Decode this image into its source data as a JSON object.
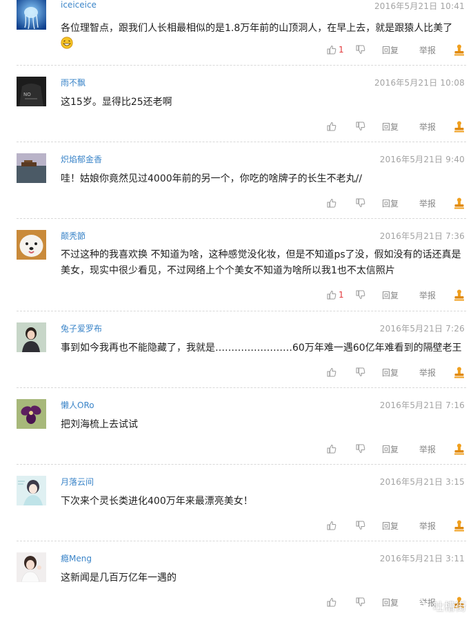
{
  "comments": [
    {
      "user": "iceiceice",
      "time": "2016年5月21日 10:41",
      "text": "各位理智点，跟我们人长相最相似的是1.8万年前的山顶洞人，在早上去，就是跟猿人比美了",
      "likes": "1",
      "reply": "回复",
      "report": "举报",
      "avatar": "jellyfish-avatar",
      "emoji": "grin-emoji"
    },
    {
      "user": "雨不飘",
      "time": "2016年5月21日 10:08",
      "text": "这15岁。显得比25还老啊",
      "likes": "",
      "reply": "回复",
      "report": "举报",
      "avatar": "dark-shirt-avatar"
    },
    {
      "user": "炽焰郁金香",
      "time": "2016年5月21日 9:40",
      "text": "哇！姑娘你竟然见过4000年前的另一个，你吃的啥牌子的长生不老丸//",
      "likes": "",
      "reply": "回复",
      "report": "举报",
      "avatar": "boat-landscape-avatar"
    },
    {
      "user": "颠秃節",
      "time": "2016年5月21日 7:36",
      "text": "不过这种的我喜欢换 不知道为啥，这种感觉没化妆，但是不知道ps了没，假如没有的话还真是美女，现实中很少看见，不过网络上个个美女不知道为啥所以我1也不太信照片",
      "likes": "1",
      "reply": "回复",
      "report": "举报",
      "avatar": "samoyed-dog-avatar"
    },
    {
      "user": "兔子爱罗布",
      "time": "2016年5月21日 7:26",
      "text": "事到如今我再也不能隐藏了，我就是……………………60万年难一遇60亿年难看到的隔壁老王",
      "likes": "",
      "reply": "回复",
      "report": "举报",
      "avatar": "girl-portrait-avatar"
    },
    {
      "user": "懒人ORo",
      "time": "2016年5月21日 7:16",
      "text": "把刘海梳上去试试",
      "likes": "",
      "reply": "回复",
      "report": "举报",
      "avatar": "orchid-flower-avatar"
    },
    {
      "user": "月落云间",
      "time": "2016年5月21日 3:15",
      "text": "下次来个灵长类进化400万年来最漂亮美女！",
      "likes": "",
      "reply": "回复",
      "report": "举报",
      "avatar": "anime-girl-avatar"
    },
    {
      "user": "瘾Meng",
      "time": "2016年5月21日 3:11",
      "text": "这新闻是几百万亿年一遇的",
      "likes": "",
      "reply": "回复",
      "report": "举报",
      "avatar": "girl-selfie-avatar"
    }
  ],
  "watermark": {
    "text": "吐槽街",
    "icon": "wechat-icon"
  },
  "colors": {
    "username": "#3a84c8",
    "time": "#a3a3a3",
    "like_count": "#e2383b",
    "stamp": "#f0a020"
  }
}
